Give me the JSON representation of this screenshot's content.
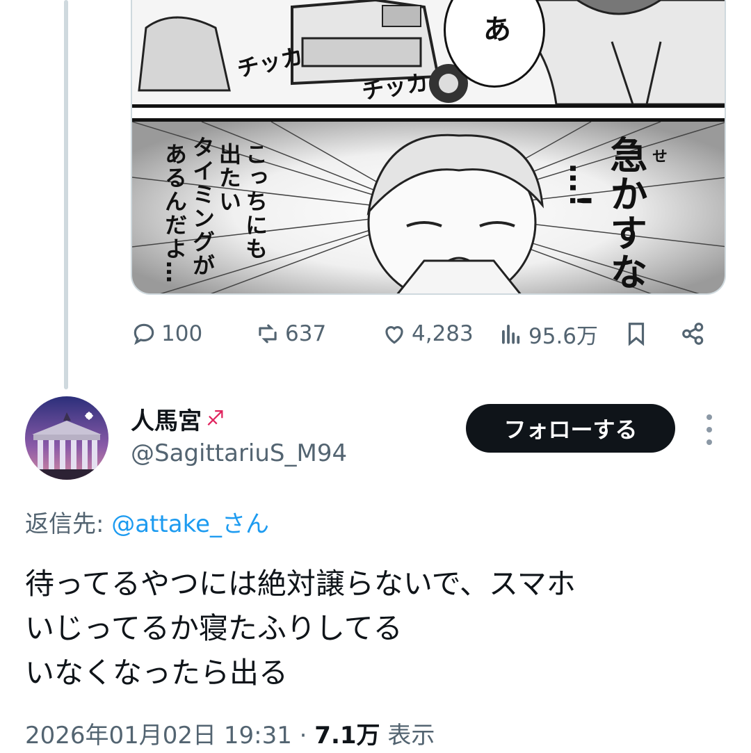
{
  "image": {
    "sfx_left": "チッカ",
    "sfx_right": "チッカ",
    "bubble_top": "あ",
    "line_a": "こっちにも",
    "line_b": "出たい",
    "line_c": "タイミングが",
    "line_d": "あるんだよ…",
    "shout": "急かすな",
    "ruby": "せ",
    "ellipsis": "…!"
  },
  "actions": {
    "replies": "100",
    "reposts": "637",
    "likes": "4,283",
    "views": "95.6万"
  },
  "reply": {
    "display_name": "人馬宮",
    "badge": "♐",
    "handle": "@SagittariuS_M94",
    "follow_label": "フォローする",
    "reply_prefix": "返信先: ",
    "reply_mention": "@attake_さん",
    "text": "待ってるやつには絶対譲らないで、スマホ\nいじってるか寝たふりしてる\nいなくなったら出る",
    "date": "2026年01月02日 19:31 · ",
    "view_count": "7.1万",
    "view_suffix": " 表示"
  },
  "colors": {
    "accent": "#1d9bf0",
    "muted": "#536471",
    "text": "#0f1419"
  }
}
